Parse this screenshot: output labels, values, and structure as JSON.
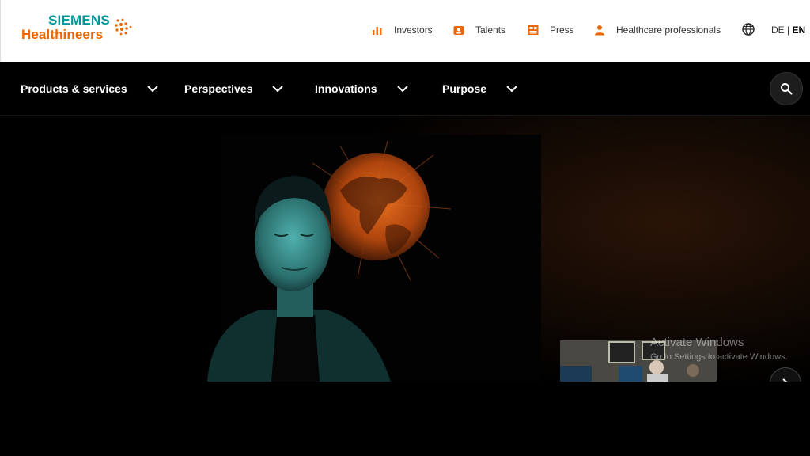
{
  "logo": {
    "line1": "SIEMENS",
    "line2": "Healthineers",
    "brand_color": "#ec6602",
    "secondary_color": "#009999"
  },
  "utility_nav": [
    {
      "label": "Investors",
      "icon": "bar-chart-icon"
    },
    {
      "label": "Talents",
      "icon": "badge-icon"
    },
    {
      "label": "Press",
      "icon": "news-icon"
    },
    {
      "label": "Healthcare professionals",
      "icon": "person-icon"
    }
  ],
  "language": {
    "icon": "globe-icon",
    "de": "DE",
    "separator": "|",
    "en": "EN",
    "selected": "EN"
  },
  "main_nav": [
    {
      "label": "Products & services"
    },
    {
      "label": "Perspectives"
    },
    {
      "label": "Innovations"
    },
    {
      "label": "Purpose"
    }
  ],
  "search": {
    "icon": "search-icon"
  },
  "hero": {
    "image": "man-with-globe-hologram",
    "carousel_next_icon": "chevron-right-icon"
  },
  "watermark": {
    "title": "Activate Windows",
    "subtitle": "Go to Settings to activate Windows."
  }
}
